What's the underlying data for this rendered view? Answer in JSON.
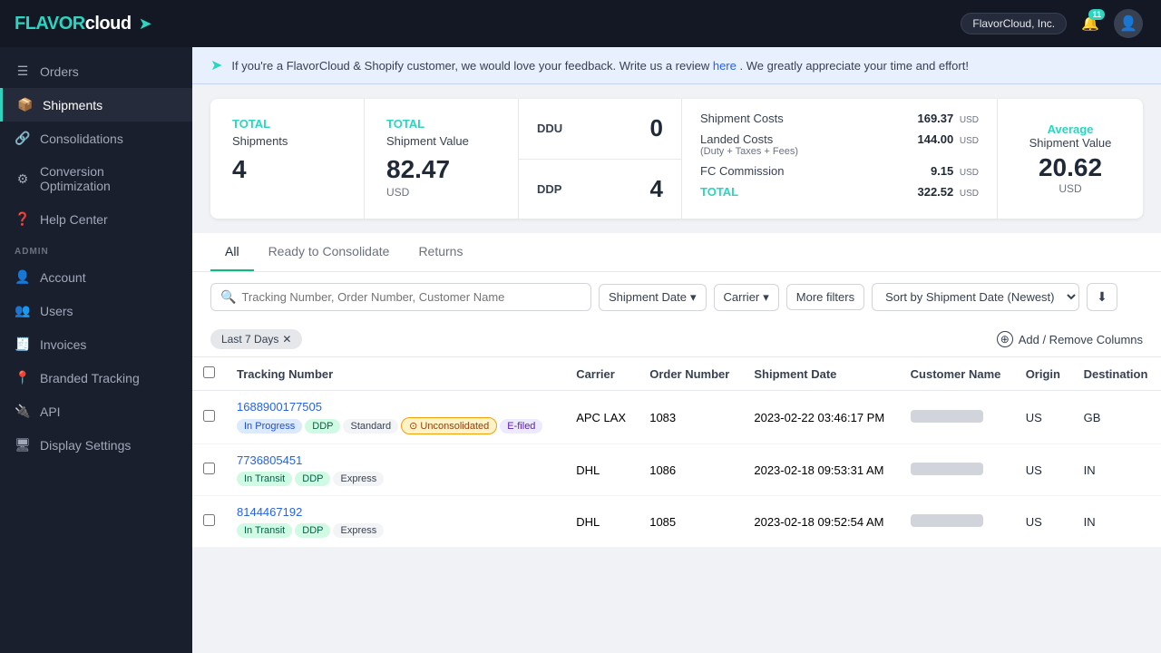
{
  "sidebar": {
    "logo": "FlavorCloud",
    "company": "FlavorCloud, Inc.",
    "nav": [
      {
        "id": "orders",
        "label": "Orders",
        "icon": "☰"
      },
      {
        "id": "shipments",
        "label": "Shipments",
        "icon": "📦",
        "active": true
      },
      {
        "id": "consolidations",
        "label": "Consolidations",
        "icon": "🔗"
      },
      {
        "id": "conversion",
        "label": "Conversion Optimization",
        "icon": "⚙"
      },
      {
        "id": "help",
        "label": "Help Center",
        "icon": "❓"
      }
    ],
    "admin_label": "ADMIN",
    "admin_nav": [
      {
        "id": "account",
        "label": "Account",
        "icon": "👤"
      },
      {
        "id": "users",
        "label": "Users",
        "icon": "👥"
      },
      {
        "id": "invoices",
        "label": "Invoices",
        "icon": "🧾"
      },
      {
        "id": "branded",
        "label": "Branded Tracking",
        "icon": "📍"
      },
      {
        "id": "api",
        "label": "API",
        "icon": "🔌"
      },
      {
        "id": "display",
        "label": "Display Settings",
        "icon": "🖥"
      }
    ]
  },
  "topbar": {
    "company": "FlavorCloud, Inc.",
    "notif_count": "11"
  },
  "banner": {
    "text": "If you're a FlavorCloud & Shopify customer, we would love your feedback. Write us a review ",
    "link_text": "here",
    "text_after": ". We greatly appreciate your time and effort!"
  },
  "stats": {
    "total_shipments_label": "TOTAL",
    "total_shipments_sub": "Shipments",
    "total_shipments_value": "4",
    "total_value_label": "TOTAL",
    "total_value_sub": "Shipment Value",
    "total_value_num": "82.47",
    "total_value_usd": "USD",
    "ddu_label": "DDU",
    "ddu_value": "0",
    "ddp_label": "DDP",
    "ddp_value": "4",
    "shipment_costs_label": "Shipment Costs",
    "shipment_costs_value": "169.37",
    "shipment_costs_usd": "USD",
    "landed_costs_label": "Landed Costs",
    "landed_costs_sub": "(Duty + Taxes + Fees)",
    "landed_costs_value": "144.00",
    "landed_costs_usd": "USD",
    "fc_commission_label": "FC Commission",
    "fc_commission_value": "9.15",
    "fc_commission_usd": "USD",
    "total_label": "TOTAL",
    "total_value": "322.52",
    "total_usd": "USD",
    "average_label": "Average",
    "average_sub": "Shipment Value",
    "average_value": "20.62",
    "average_usd": "USD"
  },
  "tabs": [
    {
      "id": "all",
      "label": "All",
      "active": true
    },
    {
      "id": "ready",
      "label": "Ready to Consolidate"
    },
    {
      "id": "returns",
      "label": "Returns"
    }
  ],
  "filters": {
    "search_placeholder": "Tracking Number, Order Number, Customer Name",
    "shipment_date_label": "Shipment Date",
    "carrier_label": "Carrier",
    "more_filters_label": "More filters",
    "sort_label": "Sort by Shipment Date (Newest)",
    "last_days_chip": "Last 7 Days",
    "add_columns_label": "Add / Remove Columns"
  },
  "table": {
    "columns": [
      {
        "id": "check",
        "label": ""
      },
      {
        "id": "tracking",
        "label": "Tracking Number"
      },
      {
        "id": "carrier",
        "label": "Carrier"
      },
      {
        "id": "order",
        "label": "Order Number"
      },
      {
        "id": "date",
        "label": "Shipment Date"
      },
      {
        "id": "customer",
        "label": "Customer Name"
      },
      {
        "id": "origin",
        "label": "Origin"
      },
      {
        "id": "destination",
        "label": "Destination"
      }
    ],
    "rows": [
      {
        "tracking_number": "1688900177505",
        "badges": [
          {
            "label": "In Progress",
            "type": "inprogress"
          },
          {
            "label": "DDP",
            "type": "ddp"
          },
          {
            "label": "Standard",
            "type": "standard"
          },
          {
            "label": "⊙ Unconsolidated",
            "type": "unconsolidated"
          },
          {
            "label": "E-filed",
            "type": "efiled"
          }
        ],
        "carrier": "APC LAX",
        "order_number": "1083",
        "shipment_date": "2023-02-22 03:46:17 PM",
        "origin": "US",
        "destination": "GB"
      },
      {
        "tracking_number": "7736805451",
        "badges": [
          {
            "label": "In Transit",
            "type": "intransit"
          },
          {
            "label": "DDP",
            "type": "ddp"
          },
          {
            "label": "Express",
            "type": "express"
          }
        ],
        "carrier": "DHL",
        "order_number": "1086",
        "shipment_date": "2023-02-18 09:53:31 AM",
        "origin": "US",
        "destination": "IN"
      },
      {
        "tracking_number": "8144467192",
        "badges": [
          {
            "label": "In Transit",
            "type": "intransit"
          },
          {
            "label": "DDP",
            "type": "ddp"
          },
          {
            "label": "Express",
            "type": "express"
          }
        ],
        "carrier": "DHL",
        "order_number": "1085",
        "shipment_date": "2023-02-18 09:52:54 AM",
        "origin": "US",
        "destination": "IN"
      }
    ]
  }
}
